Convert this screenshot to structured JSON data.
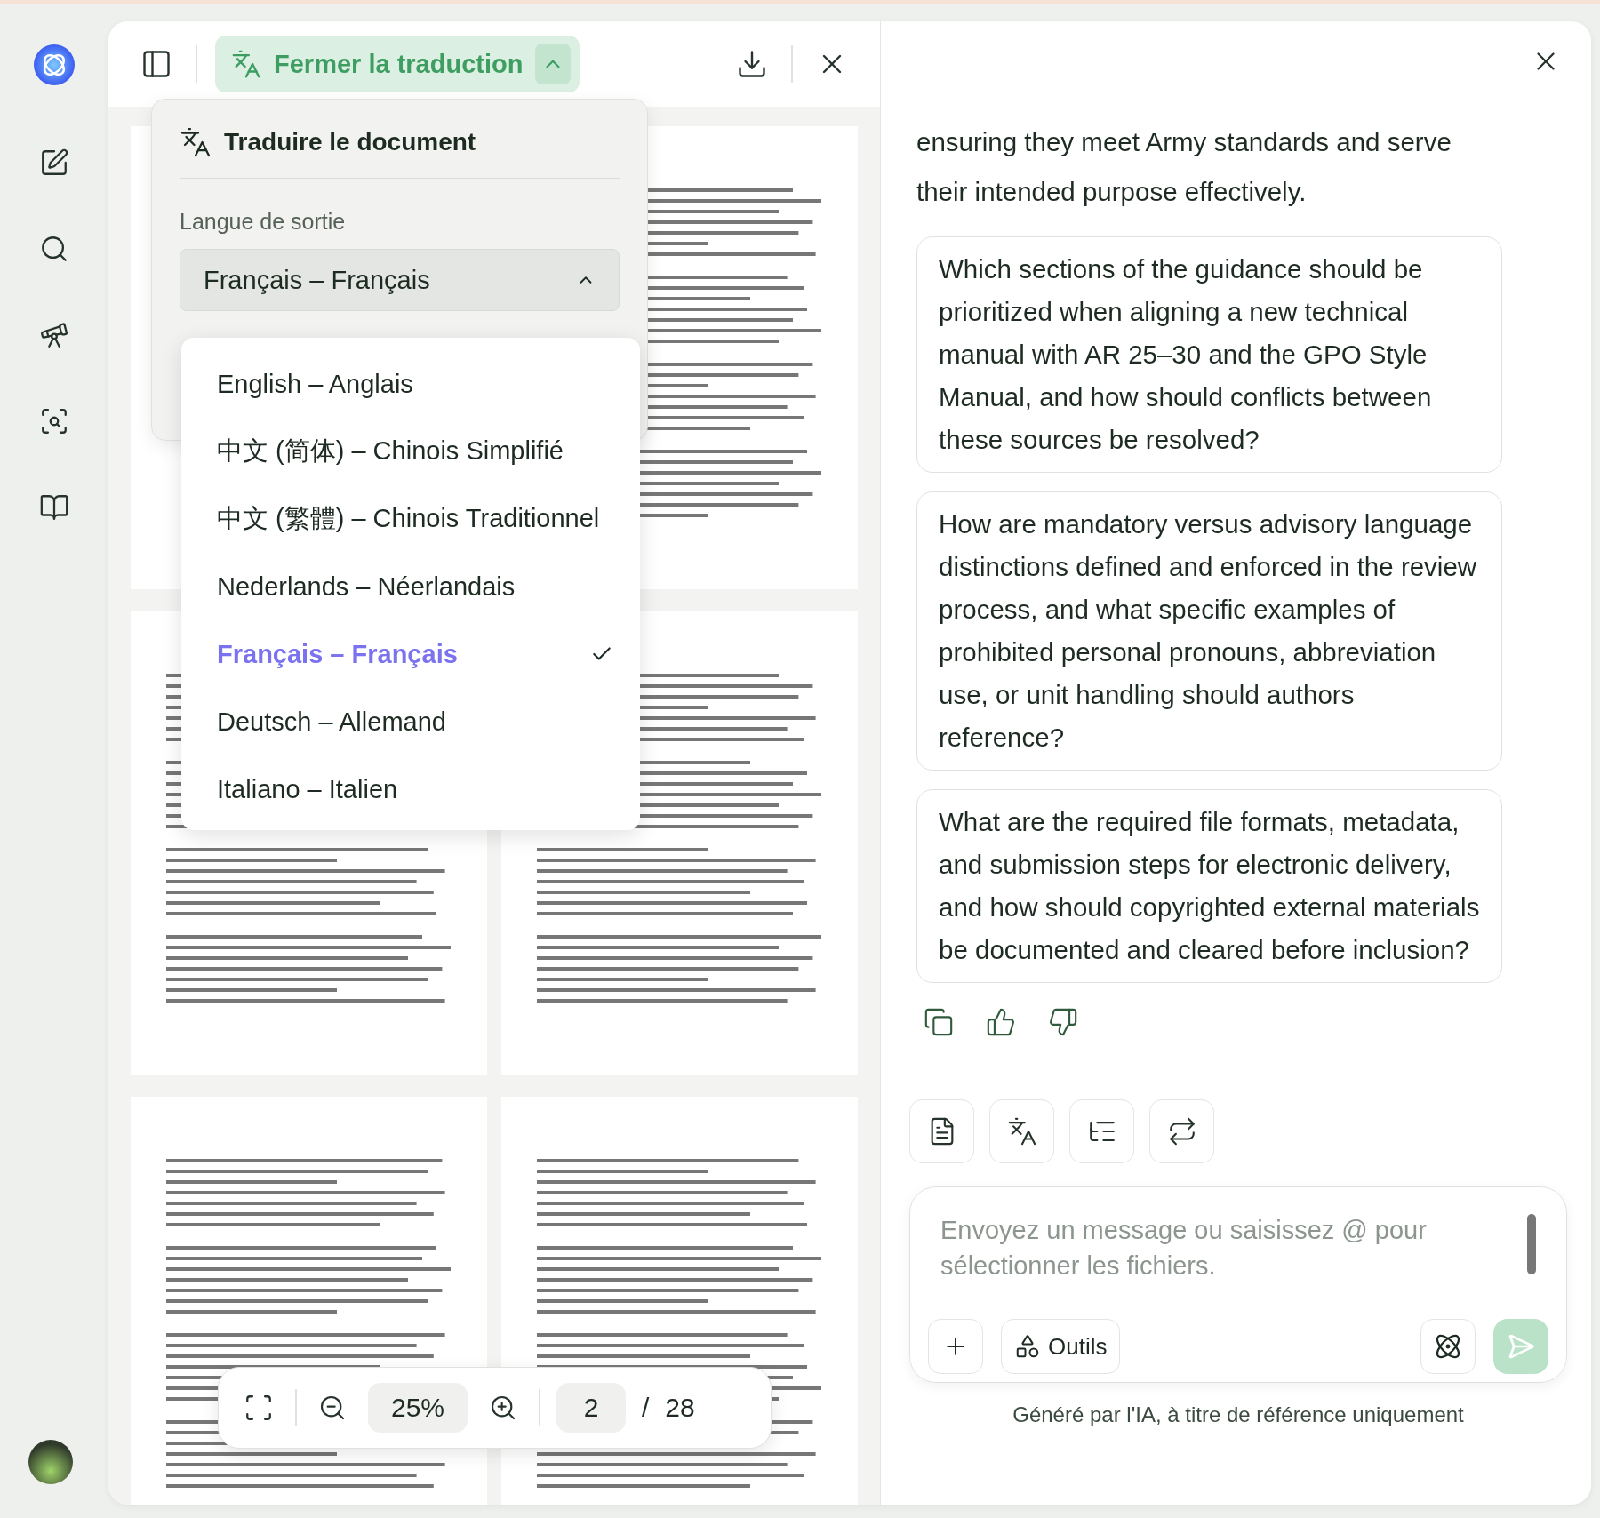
{
  "doc_toolbar": {
    "translate_button": "Fermer la traduction"
  },
  "translate_panel": {
    "title": "Traduire le document",
    "language_label": "Langue de sortie",
    "selected_language": "Français – Français",
    "expanded": true,
    "options": [
      {
        "label": "English – Anglais",
        "selected": false
      },
      {
        "label": "中文 (简体) – Chinois Simplifié",
        "selected": false
      },
      {
        "label": "中文 (繁體) – Chinois Traditionnel",
        "selected": false
      },
      {
        "label": "Nederlands – Néerlandais",
        "selected": false
      },
      {
        "label": "Français – Français",
        "selected": true
      },
      {
        "label": "Deutsch – Allemand",
        "selected": false
      },
      {
        "label": "Italiano – Italien",
        "selected": false
      }
    ]
  },
  "zoom_bar": {
    "zoom": "25%",
    "page": "2",
    "separator": "/",
    "page_total": "28"
  },
  "chat": {
    "intro": "ensuring they meet Army standards and serve their intended purpose effectively.",
    "suggestions": [
      "Which sections of the guidance should be prioritized when aligning a new technical manual with AR 25–30 and the GPO Style Manual, and how should conflicts between these sources be resolved?",
      "How are mandatory versus advisory language distinctions defined and enforced in the review process, and what specific examples of prohibited personal pronouns, abbreviation use, or unit handling should authors reference?",
      "What are the required file formats, metadata, and submission steps for electronic delivery, and how should copyrighted external materials be documented and cleared before inclusion?"
    ],
    "input": {
      "placeholder": "Envoyez un message ou saisissez @ pour sélectionner les fichiers."
    },
    "tools_label": "Outils",
    "footer": "Généré par l'IA, à titre de référence uniquement"
  }
}
